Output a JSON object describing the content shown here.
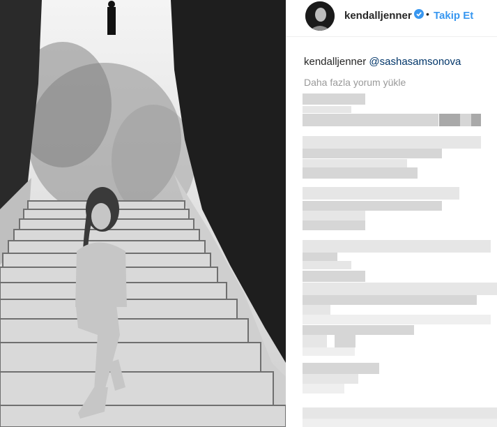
{
  "post": {
    "author": "kendalljenner",
    "follow_separator": "•",
    "follow_label": "Takip Et",
    "caption_user": "kendalljenner",
    "caption_mention": "@sashasamsonova",
    "load_more_comments": "Daha fazla yorum yükle"
  },
  "colors": {
    "follow_blue": "#3897f0",
    "mention": "#003569",
    "verified_badge": "#3897f0"
  },
  "icons": [
    "verified-badge-icon"
  ]
}
